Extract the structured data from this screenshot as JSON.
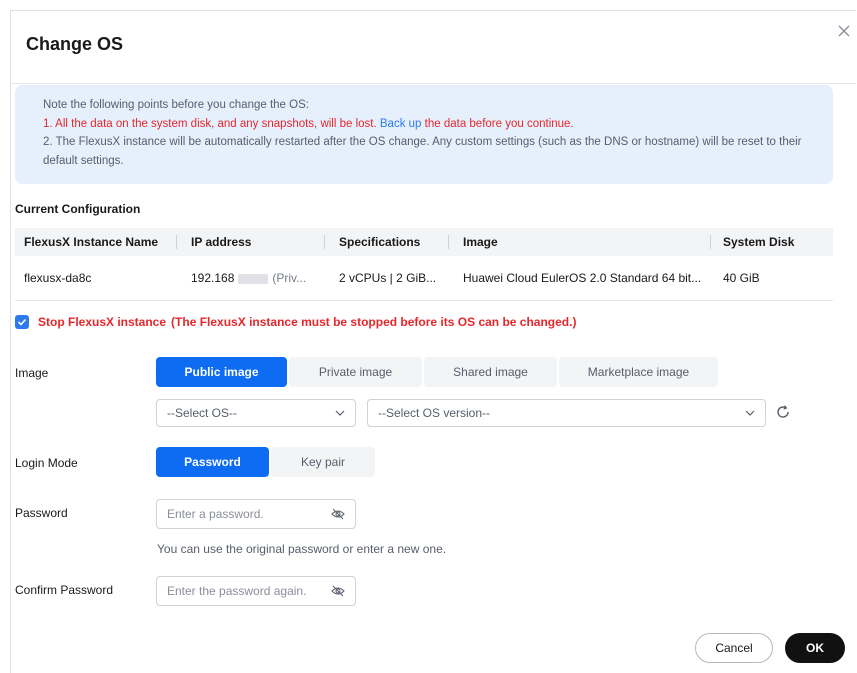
{
  "dialog": {
    "title": "Change OS"
  },
  "notice": {
    "heading": "Note the following points before you change the OS:",
    "point1_red": "1. All the data on the system disk, and any snapshots, will be lost.",
    "point1_link": "Back up",
    "point1_rest": "the data before you continue.",
    "point2": "2. The FlexusX instance will be automatically restarted after the OS change. Any custom settings (such as the DNS or hostname) will be reset to their default settings."
  },
  "config": {
    "section_title": "Current Configuration",
    "columns": [
      "FlexusX Instance Name",
      "IP address",
      "Specifications",
      "Image",
      "System Disk"
    ],
    "row": {
      "name": "flexusx-da8c",
      "ip_prefix": "192.168",
      "ip_suffix": "(Priv...",
      "specs": "2 vCPUs | 2 GiB...",
      "image": "Huawei Cloud EulerOS 2.0 Standard 64 bit...",
      "disk": "40 GiB"
    }
  },
  "stop": {
    "checked": true,
    "label": "Stop FlexusX instance",
    "note": "(The FlexusX instance must be stopped before its OS can be changed.)"
  },
  "image": {
    "label": "Image",
    "tabs": [
      "Public image",
      "Private image",
      "Shared image",
      "Marketplace image"
    ],
    "active_tab": 0,
    "os_placeholder": "--Select OS--",
    "version_placeholder": "--Select OS version--"
  },
  "login": {
    "label": "Login Mode",
    "options": [
      "Password",
      "Key pair"
    ],
    "active": 0
  },
  "password": {
    "label": "Password",
    "placeholder": "Enter a password.",
    "hint": "You can use the original password or enter a new one."
  },
  "confirm": {
    "label": "Confirm Password",
    "placeholder": "Enter the password again."
  },
  "footer": {
    "cancel": "Cancel",
    "ok": "OK"
  },
  "colors": {
    "primary": "#0e6cf2",
    "danger": "#e5272c",
    "link": "#2d79ee",
    "notice_bg": "#e6f0fd"
  }
}
